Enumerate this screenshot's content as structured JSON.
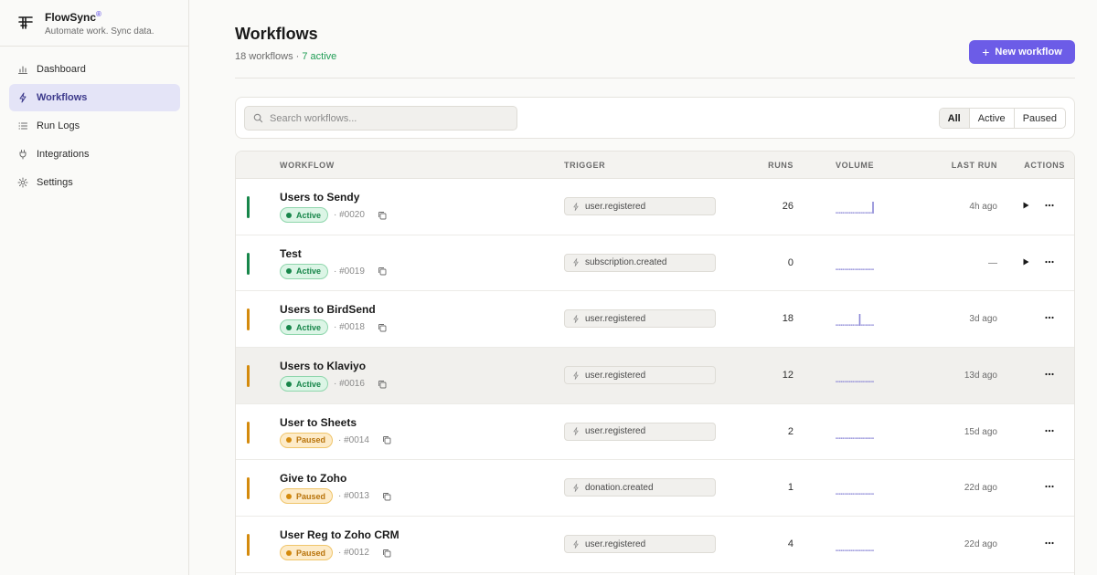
{
  "brand": {
    "name": "FlowSync",
    "mark": "®",
    "tagline": "Automate work. Sync data."
  },
  "nav": [
    {
      "label": "Dashboard",
      "icon": "bar-chart-icon"
    },
    {
      "label": "Workflows",
      "icon": "bolt-icon",
      "active": true
    },
    {
      "label": "Run Logs",
      "icon": "list-icon"
    },
    {
      "label": "Integrations",
      "icon": "plug-icon"
    },
    {
      "label": "Settings",
      "icon": "gear-icon"
    }
  ],
  "header": {
    "title": "Workflows",
    "count_text": "18 workflows",
    "sep": " · ",
    "active_text": "7 active",
    "new_button": "New workflow"
  },
  "toolbar": {
    "search_placeholder": "Search workflows...",
    "filters": [
      "All",
      "Active",
      "Paused"
    ],
    "selected_filter": "All"
  },
  "table": {
    "columns": {
      "workflow": "WORKFLOW",
      "trigger": "TRIGGER",
      "runs": "RUNS",
      "volume": "VOLUME",
      "last_run": "LAST RUN",
      "actions": "ACTIONS"
    },
    "rows": [
      {
        "name": "Users to Sendy",
        "status": "Active",
        "id": "#0020",
        "trigger": "user.registered",
        "runs": "26",
        "last_run": "4h ago",
        "bar_color": "#17864a",
        "spark": [
          0,
          0,
          0,
          0,
          0,
          0,
          0,
          0,
          0,
          0,
          0,
          1
        ],
        "play": true
      },
      {
        "name": "Test",
        "status": "Active",
        "id": "#0019",
        "trigger": "subscription.created",
        "runs": "0",
        "last_run": "—",
        "bar_color": "#17864a",
        "spark": [
          0,
          0,
          0,
          0,
          0,
          0,
          0,
          0,
          0,
          0,
          0,
          0
        ],
        "play": true
      },
      {
        "name": "Users to BirdSend",
        "status": "Active",
        "id": "#0018",
        "trigger": "user.registered",
        "runs": "18",
        "last_run": "3d ago",
        "bar_color": "#d48a0c",
        "spark": [
          0,
          0,
          0,
          0,
          0,
          0,
          0,
          1,
          0,
          0,
          0,
          0
        ],
        "play": false
      },
      {
        "name": "Users to Klaviyo",
        "status": "Active",
        "id": "#0016",
        "trigger": "user.registered",
        "runs": "12",
        "last_run": "13d ago",
        "bar_color": "#d48a0c",
        "spark": [
          0,
          0,
          0,
          0,
          0,
          0,
          0,
          0,
          0,
          0,
          0,
          0
        ],
        "play": false,
        "hover": true
      },
      {
        "name": "User to Sheets",
        "status": "Paused",
        "id": "#0014",
        "trigger": "user.registered",
        "runs": "2",
        "last_run": "15d ago",
        "bar_color": "#d48a0c",
        "spark": [
          0,
          0,
          0,
          0,
          0,
          0,
          0,
          0,
          0,
          0,
          0,
          0
        ],
        "play": false
      },
      {
        "name": "Give to Zoho",
        "status": "Paused",
        "id": "#0013",
        "trigger": "donation.created",
        "runs": "1",
        "last_run": "22d ago",
        "bar_color": "#d48a0c",
        "spark": [
          0,
          0,
          0,
          0,
          0,
          0,
          0,
          0,
          0,
          0,
          0,
          0
        ],
        "play": false
      },
      {
        "name": "User Reg to Zoho CRM",
        "status": "Paused",
        "id": "#0012",
        "trigger": "user.registered",
        "runs": "4",
        "last_run": "22d ago",
        "bar_color": "#d48a0c",
        "spark": [
          0,
          0,
          0,
          0,
          0,
          0,
          0,
          0,
          0,
          0,
          0,
          0
        ],
        "play": false
      }
    ]
  },
  "colors": {
    "accent": "#6c5ce7",
    "active": "#17864a",
    "paused": "#d48a0c"
  }
}
